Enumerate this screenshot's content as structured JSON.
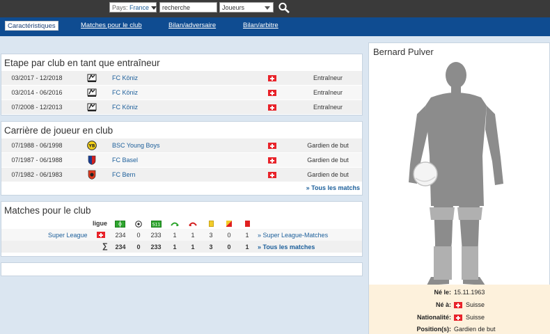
{
  "search": {
    "country_prefix": "Pays:",
    "country_value": "France",
    "search_placeholder": "recherche",
    "search_value": "recherche",
    "type_value": "Joueurs"
  },
  "nav": {
    "tabs": [
      "Caractéristiques",
      "Matches pour le club",
      "Bilan/adversaire",
      "Bilan/arbitre"
    ],
    "active_index": 0
  },
  "coach": {
    "title": "Etape par club en tant que entraîneur",
    "rows": [
      {
        "dates": "03/2017 - 12/2018",
        "club": "FC Köniz",
        "role": "Entraîneur",
        "logo": "fc-koniz-logo"
      },
      {
        "dates": "03/2014 - 06/2016",
        "club": "FC Köniz",
        "role": "Entraîneur",
        "logo": "fc-koniz-logo"
      },
      {
        "dates": "07/2008 - 12/2013",
        "club": "FC Köniz",
        "role": "Entraîneur",
        "logo": "fc-koniz-logo"
      }
    ]
  },
  "player": {
    "title": "Carrière de joueur en club",
    "rows": [
      {
        "dates": "07/1988 - 06/1998",
        "club": "BSC Young Boys",
        "role": "Gardien de but",
        "logo": "young-boys-logo"
      },
      {
        "dates": "07/1987 - 06/1988",
        "club": "FC Basel",
        "role": "Gardien de but",
        "logo": "fc-basel-logo"
      },
      {
        "dates": "07/1982 - 06/1983",
        "club": "FC Bern",
        "role": "Gardien de but",
        "logo": "fc-bern-logo"
      }
    ],
    "more": "» Tous les matchs"
  },
  "matches": {
    "title": "Matches pour le club",
    "header_label": "ligue",
    "header_icons": [
      "appearances-icon",
      "goals-icon",
      "starts-icon",
      "sub-in-icon",
      "sub-out-icon",
      "yellow-card-icon",
      "yellow-red-card-icon",
      "red-card-icon"
    ],
    "league_row": {
      "league": "Super League",
      "values": [
        "234",
        "0",
        "233",
        "1",
        "1",
        "3",
        "0",
        "1"
      ],
      "link": "» Super League-Matches"
    },
    "total_row": {
      "symbol": "∑",
      "values": [
        "234",
        "0",
        "233",
        "1",
        "1",
        "3",
        "0",
        "1"
      ],
      "link": "» Tous les matches"
    }
  },
  "profile": {
    "name": "Bernard Pulver",
    "born_label": "Né le:",
    "born_value": "15.11.1963",
    "place_label": "Né à:",
    "place_value": "Suisse",
    "nationality_label": "Nationalité:",
    "nationality_value": "Suisse",
    "position_label": "Position(s):",
    "position_value": "Gardien de but"
  },
  "colors": {
    "nav_blue": "#0f4c91",
    "link_blue": "#1b5e9a",
    "swiss_red": "#e8232a",
    "info_bg": "#fdf1dc"
  }
}
